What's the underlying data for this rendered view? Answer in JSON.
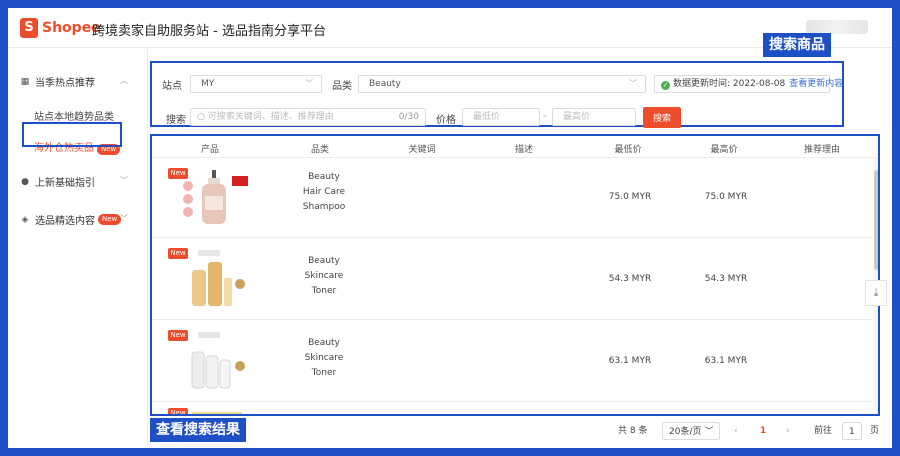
{
  "header": {
    "logo_glyph": "S",
    "logo_text": "Shopee",
    "title": "跨境卖家自助服务站 - 选品指南分享平台"
  },
  "sidebar": {
    "group1": "当季热点推荐",
    "item1": "站点本地趋势品类",
    "item2": "海外仓热卖品",
    "item2_badge": "New",
    "group2": "上新基础指引",
    "group3": "选品精选内容",
    "group3_badge": "New"
  },
  "search": {
    "site_label": "站点",
    "site_value": "MY",
    "category_label": "品类",
    "category_value": "Beauty",
    "update_text": "数据更新时间: 2022-08-08",
    "update_link": "查看更新内容",
    "keyword_label": "搜索",
    "keyword_placeholder": "可搜索关键词、描述、推荐理由",
    "keyword_count": "0/30",
    "price_label": "价格",
    "min_placeholder": "最低价",
    "max_placeholder": "最高价",
    "dash": "-",
    "button": "搜索"
  },
  "callouts": {
    "search": "搜索商品",
    "results": "查看搜索结果"
  },
  "table": {
    "headers": [
      "产品",
      "品类",
      "关键词",
      "描述",
      "最低价",
      "最高价",
      "推荐理由"
    ],
    "rows": [
      {
        "tag": "New",
        "cat1": "Beauty",
        "cat2": "Hair Care",
        "cat3": "Shampoo",
        "min": "75.0 MYR",
        "max": "75.0 MYR"
      },
      {
        "tag": "New",
        "cat1": "Beauty",
        "cat2": "Skincare",
        "cat3": "Toner",
        "min": "54.3 MYR",
        "max": "54.3 MYR"
      },
      {
        "tag": "New",
        "cat1": "Beauty",
        "cat2": "Skincare",
        "cat3": "Toner",
        "min": "63.1 MYR",
        "max": "63.1 MYR"
      },
      {
        "tag": "New"
      }
    ]
  },
  "pagination": {
    "total": "共 8 条",
    "page_size": "20条/页",
    "prev": "‹",
    "current": "1",
    "next": "›",
    "goto_label": "前往",
    "goto_value": "1",
    "page_suffix": "页"
  },
  "colors": {
    "brand": "#ee4d2d",
    "annotation": "#1f4fc4"
  }
}
